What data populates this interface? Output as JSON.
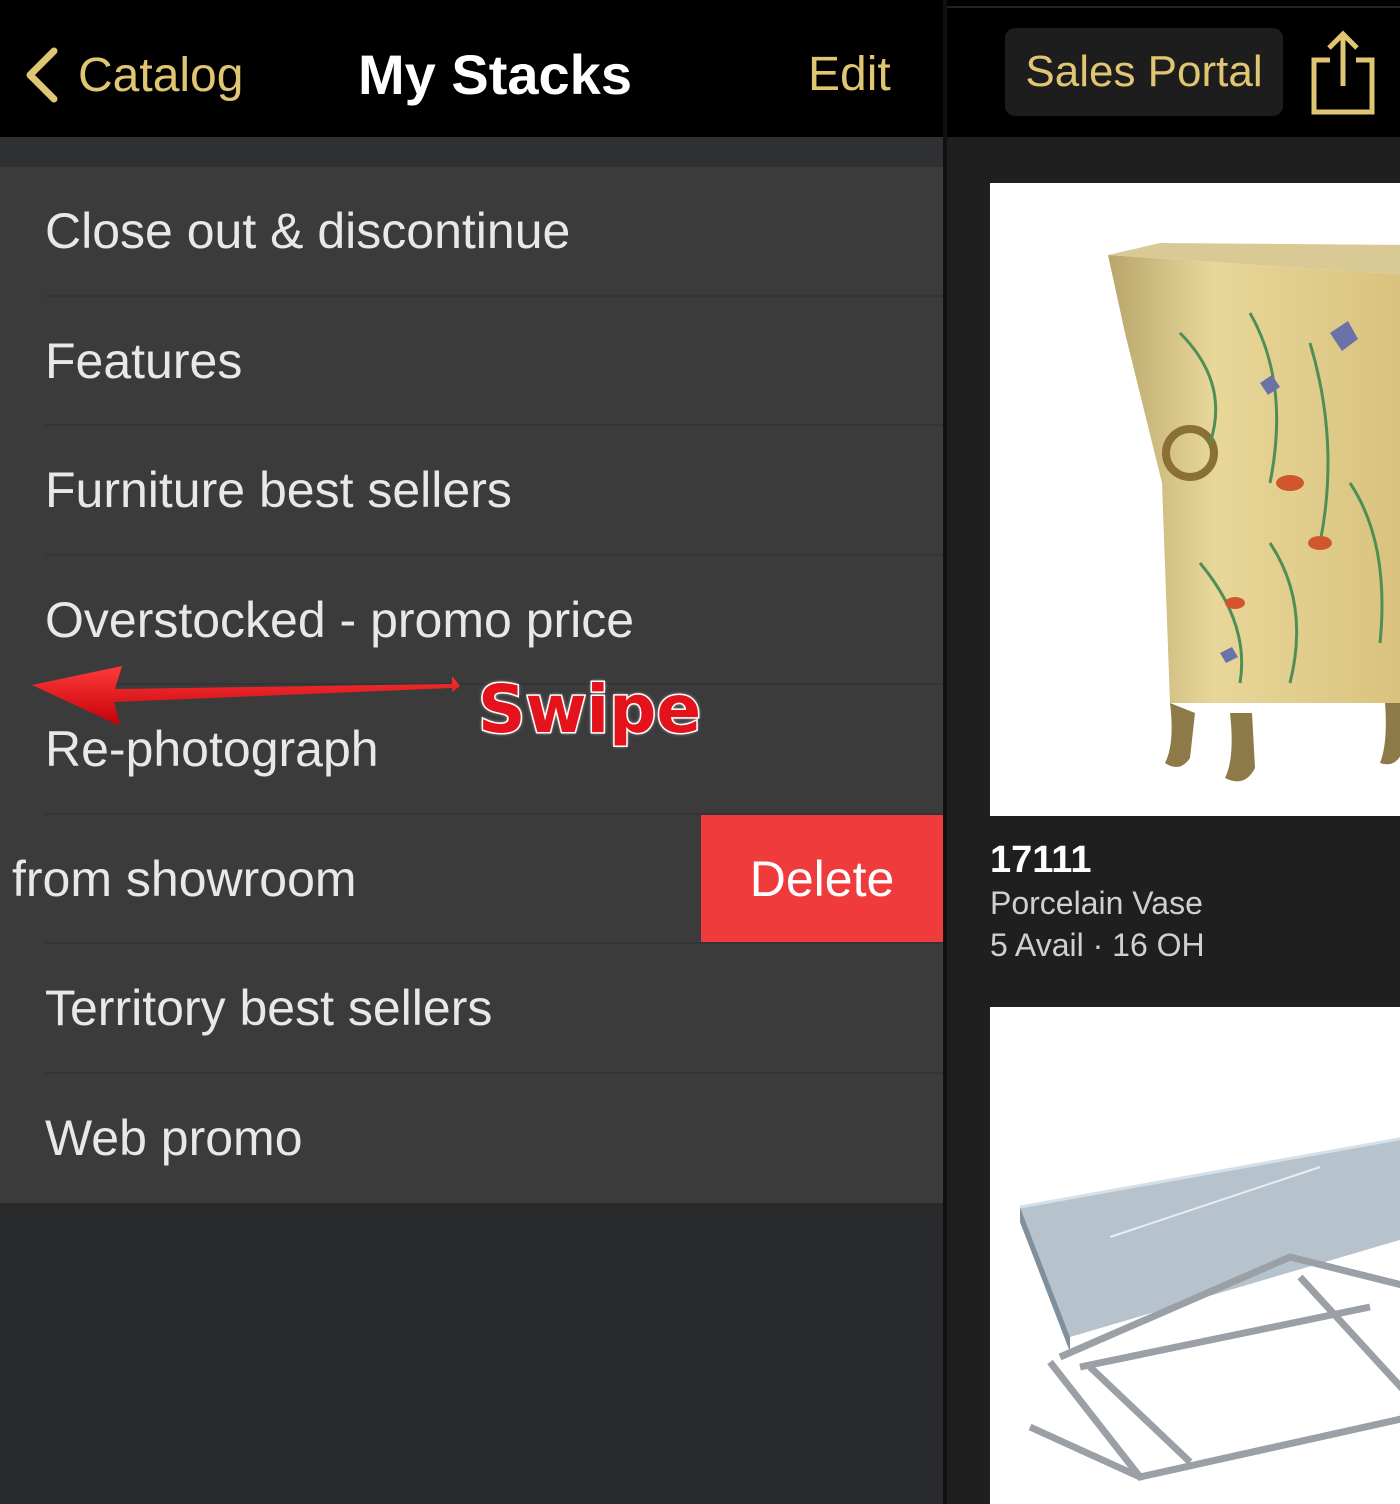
{
  "left_nav": {
    "back_label": "Catalog",
    "title": "My Stacks",
    "edit_label": "Edit"
  },
  "stacks": [
    {
      "label": "Close out & discontinue"
    },
    {
      "label": "Features"
    },
    {
      "label": "Furniture best sellers"
    },
    {
      "label": "Overstocked - promo price"
    },
    {
      "label": "Re-photograph"
    },
    {
      "label": "from showroom"
    },
    {
      "label": "Territory best sellers"
    },
    {
      "label": "Web promo"
    }
  ],
  "swiped_row": {
    "delete_label": "Delete",
    "annotation": "Swipe"
  },
  "right_nav": {
    "sales_portal_label": "Sales Portal",
    "share_icon": "share-icon"
  },
  "products": [
    {
      "sku": "17111",
      "name": "Porcelain Vase",
      "stock": "5 Avail · 16 OH"
    }
  ],
  "colors": {
    "accent": "#e0c572",
    "delete": "#ef3b3b",
    "annotation": "#e4121a"
  }
}
